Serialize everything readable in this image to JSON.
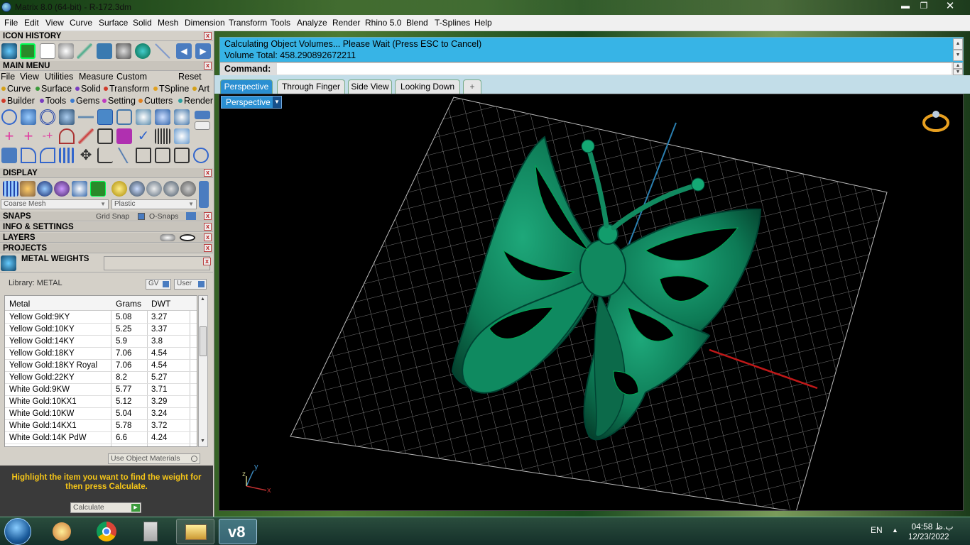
{
  "window": {
    "title": "Matrix 8.0 (64-bit) - R-172.3dm",
    "minimize_glyph": "▬",
    "maximize_glyph": "❐",
    "close_glyph": "✕"
  },
  "menubar": [
    "File",
    "Edit",
    "View",
    "Curve",
    "Surface",
    "Solid",
    "Mesh",
    "Dimension",
    "Transform",
    "Tools",
    "Analyze",
    "Render",
    "Rhino 5.0",
    "Blend",
    "T-Splines",
    "Help"
  ],
  "panels": {
    "icon_history": "ICON HISTORY",
    "main_menu": "MAIN MENU",
    "display": "DISPLAY",
    "snaps": "SNAPS",
    "info_settings": "INFO & SETTINGS",
    "layers": "LAYERS",
    "projects": "PROJECTS",
    "metal_weights": "METAL WEIGHTS",
    "close_glyph": "x"
  },
  "main_menu": {
    "top": [
      "File",
      "View",
      "Utilities",
      "Measure",
      "Custom"
    ],
    "reset": "Reset",
    "row1": [
      {
        "label": "Curve",
        "color": "#d4a017"
      },
      {
        "label": "Surface",
        "color": "#3a9a3a"
      },
      {
        "label": "Solid",
        "color": "#7a3cc0"
      },
      {
        "label": "Transform",
        "color": "#d03a2a"
      },
      {
        "label": "TSpline",
        "color": "#e0a020"
      },
      {
        "label": "Art",
        "color": "#d4a017"
      }
    ],
    "row2": [
      {
        "label": "Builder",
        "color": "#d03a2a"
      },
      {
        "label": "Tools",
        "color": "#7a3cc0"
      },
      {
        "label": "Gems",
        "color": "#3a7ad0"
      },
      {
        "label": "Setting",
        "color": "#c03ac0"
      },
      {
        "label": "Cutters",
        "color": "#e08020"
      },
      {
        "label": "Render",
        "color": "#2aa0a0"
      }
    ]
  },
  "display": {
    "mesh_select": "Coarse Mesh",
    "material_select": "Plastic"
  },
  "snaps": {
    "grid_snap": "Grid Snap",
    "o_snaps": "O-Snaps"
  },
  "metal_weights": {
    "library_label": "Library: METAL",
    "gv_label": "GV",
    "user_label": "User",
    "columns": [
      "Metal",
      "Grams",
      "DWT"
    ],
    "rows": [
      [
        "Yellow Gold:9KY",
        "5.08",
        "3.27"
      ],
      [
        "Yellow Gold:10KY",
        "5.25",
        "3.37"
      ],
      [
        "Yellow Gold:14KY",
        "5.9",
        "3.8"
      ],
      [
        "Yellow Gold:18KY",
        "7.06",
        "4.54"
      ],
      [
        "Yellow Gold:18KY Royal",
        "7.06",
        "4.54"
      ],
      [
        "Yellow Gold:22KY",
        "8.2",
        "5.27"
      ],
      [
        "White Gold:9KW",
        "5.77",
        "3.71"
      ],
      [
        "White Gold:10KX1",
        "5.12",
        "3.29"
      ],
      [
        "White Gold:10KW",
        "5.04",
        "3.24"
      ],
      [
        "White Gold:14KX1",
        "5.78",
        "3.72"
      ],
      [
        "White Gold:14K PdW",
        "6.6",
        "4.24"
      ]
    ],
    "use_object_materials": "Use Object Materials",
    "hint": "Highlight the item you want to find the weight for then press Calculate.",
    "calculate": "Calculate"
  },
  "command": {
    "line1": "Calculating Object Volumes... Please Wait (Press ESC to Cancel)",
    "line2": "Volume Total: 458.290892672211",
    "prompt": "Command:"
  },
  "viewport_tabs": [
    "Perspective",
    "Through Finger",
    "Side View",
    "Looking Down"
  ],
  "add_tab_glyph": "+",
  "viewport": {
    "name": "Perspective",
    "axis_x": "x",
    "axis_y": "y",
    "axis_z": "z"
  },
  "taskbar": {
    "language": "EN",
    "time": "04:58 ب.ظ",
    "date": "12/23/2022",
    "v8_label": "v8"
  }
}
